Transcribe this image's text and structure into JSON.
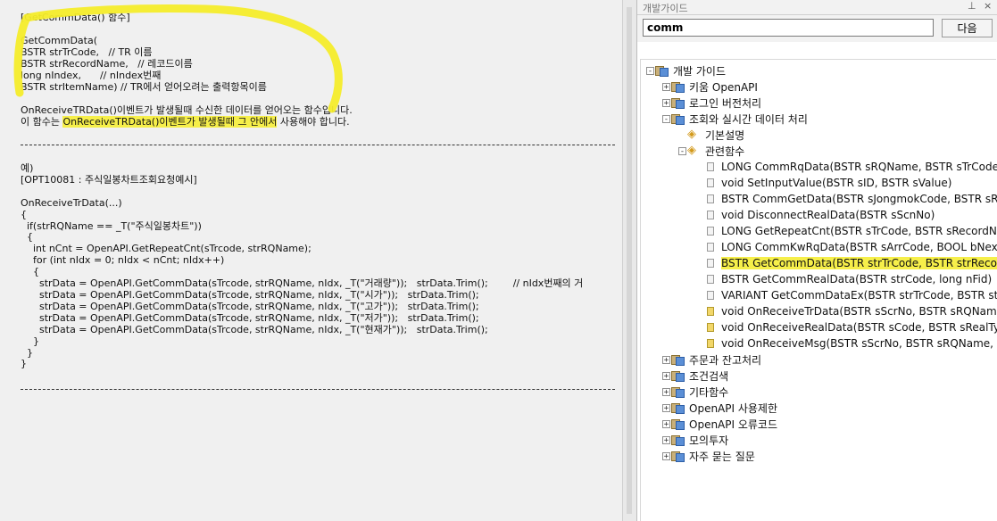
{
  "doc": {
    "header": "[GetCommData() 함수]",
    "signature": [
      "GetCommData(",
      "BSTR strTrCode,   // TR 이름",
      "BSTR strRecordName,   // 레코드이름",
      "long nIndex,      // nIndex번째",
      "BSTR strItemName) // TR에서 얻어오려는 출력항목이름"
    ],
    "desc_line1": "OnReceiveTRData()이벤트가 발생될때 수신한 데이터를 얻어오는 함수입니다.",
    "desc_line2_pre": "이 함수는 ",
    "desc_line2_hl": "OnReceiveTRData()이벤트가 발생될때 그 안에서",
    "desc_line2_post": " 사용해야 합니다.",
    "example": [
      "예)",
      "[OPT10081 : 주식일봉차트조회요청예시]",
      "",
      "OnReceiveTrData(...)",
      "{",
      "  if(strRQName == _T(\"주식일봉차트\"))",
      "  {",
      "    int nCnt = OpenAPI.GetRepeatCnt(sTrcode, strRQName);",
      "    for (int nIdx = 0; nIdx < nCnt; nIdx++)",
      "    {",
      "      strData = OpenAPI.GetCommData(sTrcode, strRQName, nIdx, _T(\"거래량\"));   strData.Trim();        // nIdx번째의 거",
      "      strData = OpenAPI.GetCommData(sTrcode, strRQName, nIdx, _T(\"시가\"));   strData.Trim();",
      "      strData = OpenAPI.GetCommData(sTrcode, strRQName, nIdx, _T(\"고가\"));   strData.Trim();",
      "      strData = OpenAPI.GetCommData(sTrcode, strRQName, nIdx, _T(\"저가\"));   strData.Trim();",
      "      strData = OpenAPI.GetCommData(sTrcode, strRQName, nIdx, _T(\"현재가\"));   strData.Trim();",
      "    }",
      "  }",
      "}"
    ]
  },
  "panel": {
    "title": "개발가이드",
    "pin_icon": "pin-icon",
    "close_icon": "close-icon",
    "search_value": "comm",
    "next_label": "다음",
    "tree": [
      {
        "label": "개발 가이드",
        "level": 0,
        "icon": "folder",
        "expander": "−"
      },
      {
        "label": "키움 OpenAPI",
        "level": 1,
        "icon": "folder",
        "expander": "+"
      },
      {
        "label": "로그인 버전처리",
        "level": 1,
        "icon": "folder",
        "expander": "+"
      },
      {
        "label": "조회와 실시간 데이터 처리",
        "level": 1,
        "icon": "folder",
        "expander": "−"
      },
      {
        "label": "기본설명",
        "level": 2,
        "icon": "tag",
        "expander": ""
      },
      {
        "label": "관련함수",
        "level": 2,
        "icon": "tag",
        "expander": "−"
      },
      {
        "label": "LONG CommRqData(BSTR sRQName, BSTR sTrCode, lo",
        "level": 3,
        "icon": "page",
        "expander": ""
      },
      {
        "label": "void SetInputValue(BSTR sID, BSTR sValue)",
        "level": 3,
        "icon": "page",
        "expander": ""
      },
      {
        "label": "BSTR CommGetData(BSTR sJongmokCode, BSTR sReal",
        "level": 3,
        "icon": "page",
        "expander": ""
      },
      {
        "label": "void DisconnectRealData(BSTR sScnNo)",
        "level": 3,
        "icon": "page",
        "expander": ""
      },
      {
        "label": "LONG GetRepeatCnt(BSTR sTrCode, BSTR sRecordNam",
        "level": 3,
        "icon": "page",
        "expander": ""
      },
      {
        "label": "LONG CommKwRqData(BSTR sArrCode, BOOL bNext, i",
        "level": 3,
        "icon": "page",
        "expander": ""
      },
      {
        "label": "BSTR GetCommData(BSTR strTrCode, BSTR strRecordN",
        "level": 3,
        "icon": "page",
        "expander": "",
        "selected": true
      },
      {
        "label": "BSTR GetCommRealData(BSTR strCode, long nFid)",
        "level": 3,
        "icon": "page",
        "expander": ""
      },
      {
        "label": "VARIANT GetCommDataEx(BSTR strTrCode, BSTR strRe",
        "level": 3,
        "icon": "page",
        "expander": ""
      },
      {
        "label": "void OnReceiveTrData(BSTR sScrNo, BSTR sRQName, B",
        "level": 3,
        "icon": "page-yellow",
        "expander": ""
      },
      {
        "label": "void OnReceiveRealData(BSTR sCode, BSTR sRealType,",
        "level": 3,
        "icon": "page-yellow",
        "expander": ""
      },
      {
        "label": "void OnReceiveMsg(BSTR sScrNo, BSTR sRQName, BST",
        "level": 3,
        "icon": "page-yellow",
        "expander": ""
      },
      {
        "label": "주문과 잔고처리",
        "level": 1,
        "icon": "folder",
        "expander": "+"
      },
      {
        "label": "조건검색",
        "level": 1,
        "icon": "folder",
        "expander": "+"
      },
      {
        "label": "기타함수",
        "level": 1,
        "icon": "folder",
        "expander": "+"
      },
      {
        "label": "OpenAPI 사용제한",
        "level": 1,
        "icon": "folder",
        "expander": "+"
      },
      {
        "label": "OpenAPI 오류코드",
        "level": 1,
        "icon": "folder",
        "expander": "+"
      },
      {
        "label": "모의투자",
        "level": 1,
        "icon": "folder",
        "expander": "+"
      },
      {
        "label": "자주 묻는 질문",
        "level": 1,
        "icon": "folder",
        "expander": "+"
      }
    ]
  }
}
